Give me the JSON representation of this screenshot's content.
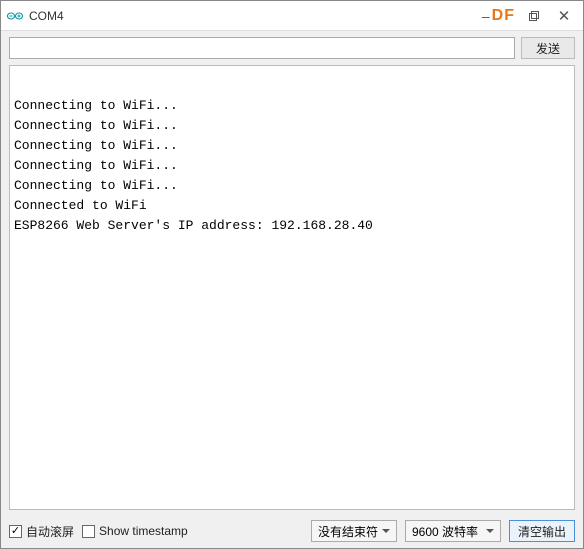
{
  "window": {
    "title": "COM4",
    "df_label": "DF"
  },
  "toolbar": {
    "input_value": "",
    "send_label": "发送"
  },
  "console": {
    "lines": [
      "Connecting to WiFi...",
      "Connecting to WiFi...",
      "Connecting to WiFi...",
      "Connecting to WiFi...",
      "Connecting to WiFi...",
      "Connected to WiFi",
      "ESP8266 Web Server's IP address: 192.168.28.40"
    ]
  },
  "bottombar": {
    "autoscroll_label": "自动滚屏",
    "timestamp_label": "Show timestamp",
    "line_ending_selected": "没有结束符",
    "baud_selected": "9600 波特率",
    "clear_label": "清空输出"
  }
}
